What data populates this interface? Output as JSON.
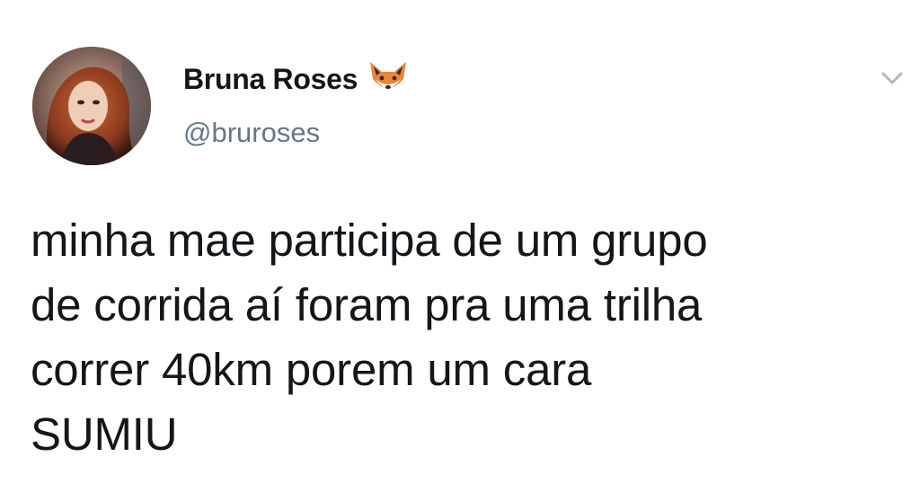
{
  "tweet": {
    "author": {
      "display_name": "Bruna Roses",
      "handle": "@bruroses",
      "badge_icon": "fox-icon"
    },
    "menu_icon": "chevron-down-icon",
    "text_lines": [
      "minha mae participa de um grupo",
      "de corrida aí foram pra uma trilha",
      "correr 40km porem um cara",
      "SUMIU"
    ]
  },
  "colors": {
    "text": "#14171a",
    "secondary": "#657786",
    "chevron": "#aab8c2",
    "background": "#ffffff"
  }
}
